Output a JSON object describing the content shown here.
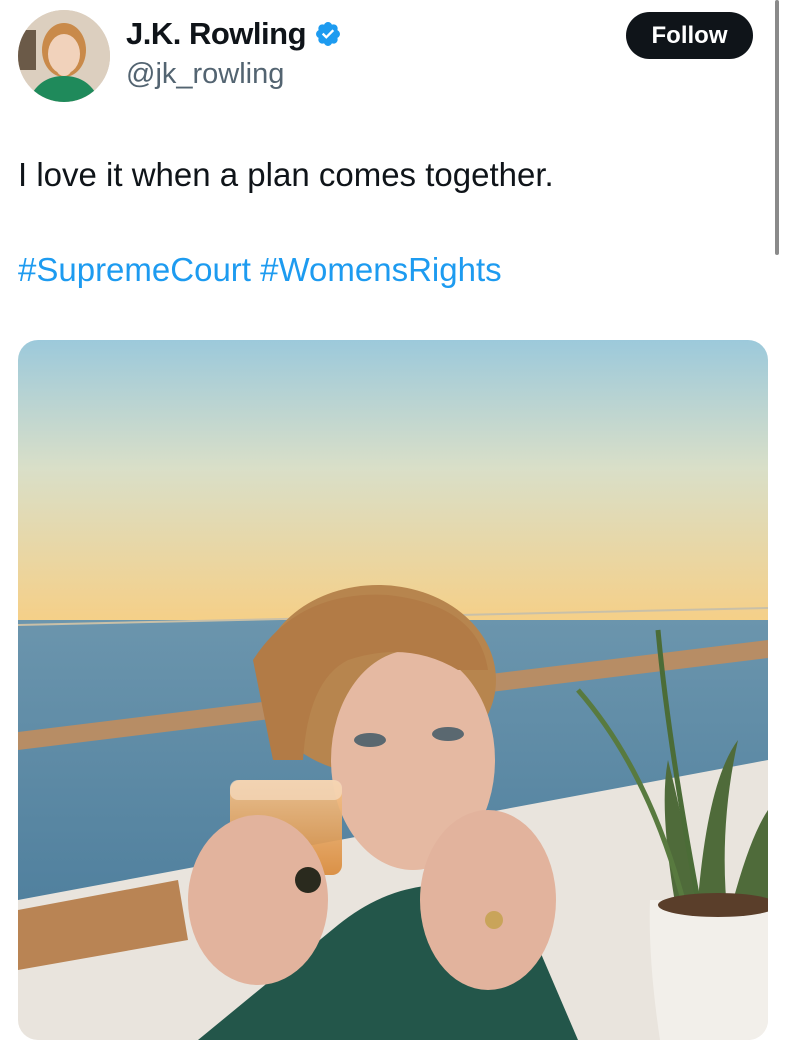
{
  "user": {
    "display_name": "J.K. Rowling",
    "handle": "@jk_rowling",
    "verified": true,
    "avatar_icon": "profile-photo"
  },
  "follow_button": {
    "label": "Follow"
  },
  "tweet": {
    "text": "I love it when a plan comes together.",
    "hashtags": [
      "#SupremeCourt",
      "#WomensRights"
    ]
  },
  "media": {
    "type": "photo",
    "subject": "sunset-sea-balcony-woman-drink-cigar"
  },
  "colors": {
    "link": "#1d9bf0",
    "text": "#0f1419",
    "secondary": "#536471",
    "button_bg": "#0f1419",
    "verified": "#1d9bf0"
  }
}
